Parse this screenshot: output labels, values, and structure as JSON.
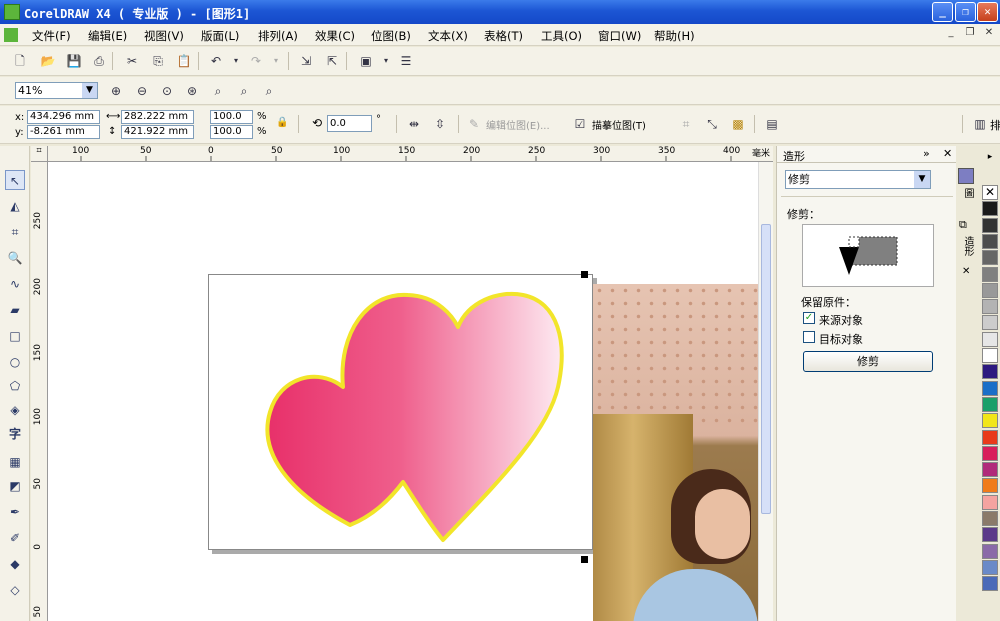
{
  "window": {
    "title": "CorelDRAW X4 ( 专业版 ) - [图形1]"
  },
  "menu": [
    "文件(F)",
    "编辑(E)",
    "视图(V)",
    "版面(L)",
    "排列(A)",
    "效果(C)",
    "位图(B)",
    "文本(X)",
    "表格(T)",
    "工具(O)",
    "窗口(W)",
    "帮助(H)"
  ],
  "zoom": {
    "value": "41%"
  },
  "propertybar": {
    "x_label": "x:",
    "y_label": "y:",
    "x": "434.296 mm",
    "y": "-8.261 mm",
    "w": "282.222 mm",
    "h": "421.922 mm",
    "scale_x": "100.0",
    "scale_y": "100.0",
    "pct": "%",
    "angle": "0.0",
    "deg": "°",
    "edit_bitmap": "编辑位图(E)...",
    "trace_bitmap": "描摹位图(T)",
    "arrange": "排"
  },
  "ruler": {
    "h_ticks": [
      "100",
      "50",
      "0",
      "50",
      "100",
      "150",
      "200",
      "250",
      "300",
      "350",
      "400"
    ],
    "h_unit": "毫米",
    "v_ticks": [
      "250",
      "200",
      "150",
      "100",
      "50",
      "0",
      "50"
    ]
  },
  "docker": {
    "title": "造形",
    "mode_select": "修剪",
    "section_label": "修剪：",
    "keep_originals": "保留原件：",
    "source_label": "来源对象",
    "source_checked": true,
    "target_label": "目标对象",
    "target_checked": false,
    "apply_button": "修剪"
  },
  "side_tabs": [
    "圖",
    "造形"
  ],
  "palette": [
    "#ffffff",
    "#1a1a1a",
    "#333333",
    "#4d4d4d",
    "#666666",
    "#808080",
    "#999999",
    "#b3b3b3",
    "#cccccc",
    "#e6e6e6",
    "#ffffff",
    "#2d1a80",
    "#1a6fc8",
    "#1aa06a",
    "#f2e619",
    "#e83a1a",
    "#d81e5b",
    "#b02a7a",
    "#f07b1a",
    "#f4a3a0",
    "#8a7a6a",
    "#5b3a8a",
    "#8a6aa8",
    "#6a8ac8",
    "#4a6ab8"
  ],
  "colors": {
    "heart_left": "#e8306a",
    "heart_right": "#fde6ef",
    "outline": "#f2e52a",
    "titlebar": "#1c56d4"
  }
}
